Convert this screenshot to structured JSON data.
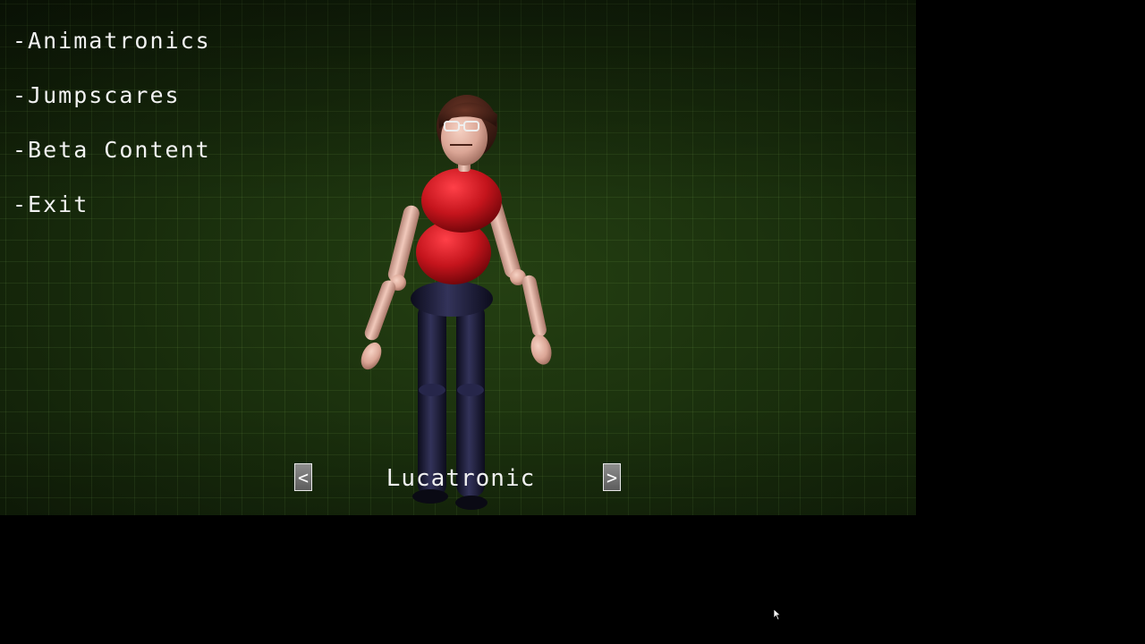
{
  "menu": {
    "items": [
      {
        "label": "-Animatronics"
      },
      {
        "label": "-Jumpscares"
      },
      {
        "label": "-Beta Content"
      },
      {
        "label": "-Exit"
      }
    ]
  },
  "viewer": {
    "character_name": "Lucatronic",
    "prev_label": "<",
    "next_label": ">"
  },
  "colors": {
    "background": "#1a2f0d",
    "grid": "#4a6a30",
    "text": "#f2f2f2",
    "shirt": "#c4141c",
    "pants": "#1e1e3c",
    "skin": "#e8b8a8"
  },
  "icons": {
    "cursor": "arrow-cursor-icon"
  }
}
